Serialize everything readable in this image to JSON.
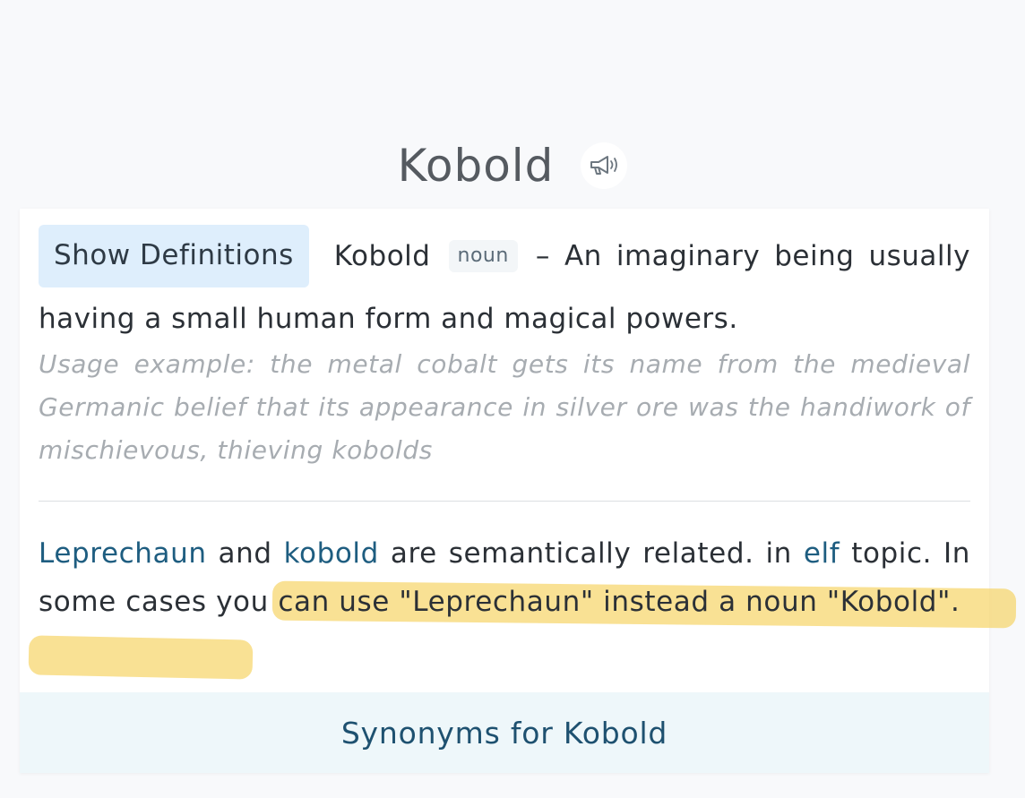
{
  "word": {
    "title": "Kobold",
    "speaker_icon": "megaphone-speaker-icon"
  },
  "definition": {
    "show_button_label": "Show Definitions",
    "term": "Kobold",
    "part_of_speech": "noun",
    "dash": "–",
    "text": "An imaginary being usually having a small human form and magical powers.",
    "usage_example": "Usage example: the metal cobalt gets its name from the medieval Germanic belief that its appearance in silver ore was the handiwork of mischievous, thieving kobolds"
  },
  "related": {
    "word1": "Leprechaun",
    "connector1": "and",
    "word2": "kobold",
    "connector2": "are semantically related. in",
    "topic": "elf",
    "connector3": "topic. In some cases you can use \"Leprechaun\" instead a noun \"Kobold\"."
  },
  "synonyms": {
    "label": "Synonyms for Kobold"
  },
  "colors": {
    "link": "#1e5d80",
    "highlight": "#f6cf52",
    "show_button_bg": "#deeefc",
    "synonyms_bg": "#eef7fa"
  }
}
